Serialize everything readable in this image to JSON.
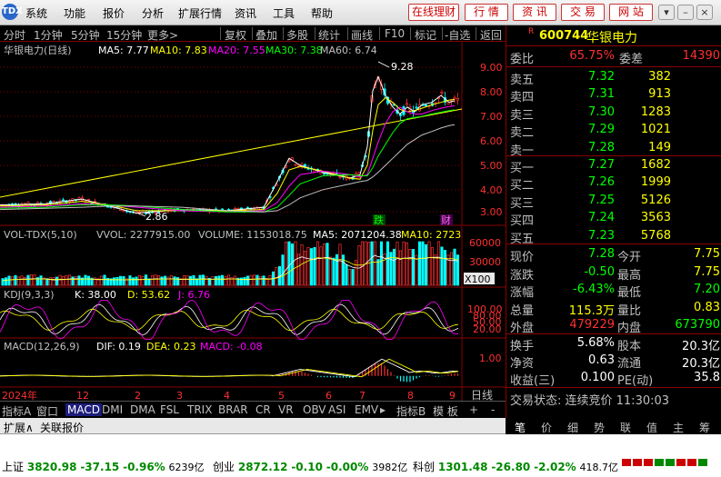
{
  "menu": {
    "logo": "TDX",
    "items": [
      "系统",
      "功能",
      "报价",
      "分析",
      "扩展行情",
      "资讯",
      "工具",
      "帮助"
    ],
    "buttons": [
      "在线理财",
      "行 情",
      "资 讯",
      "交 易",
      "网 站"
    ],
    "window_controls": [
      "▾",
      "–",
      "□",
      "×"
    ]
  },
  "timeframes": [
    "分时",
    "1分钟",
    "5分钟",
    "15分钟",
    "更多>",
    "复权",
    "叠加",
    "多股",
    "统计",
    "画线",
    "F10",
    "标记",
    "-自选",
    "返回"
  ],
  "main_chart": {
    "title": "华银电力(日线)",
    "ma5": "MA5: 7.77",
    "ma10": "MA10: 7.83",
    "ma20": "MA20: 7.55",
    "ma30": "MA30: 7.38",
    "ma60": "MA60: 6.74",
    "high_label": "9.28",
    "low_label": "2.86",
    "marker_die": "跌",
    "marker_cai": "财",
    "y_ticks": [
      "9.00",
      "8.00",
      "7.00",
      "6.00",
      "5.00",
      "4.00",
      "3.00"
    ]
  },
  "volume_chart": {
    "title": "VOL-TDX(5,10)",
    "vvol": "VVOL: 2277915.00",
    "volume": "VOLUME: 1153018.75",
    "ma5": "MA5: 2071204.38",
    "ma10": "MA10: 2723",
    "y_ticks": [
      "60000",
      "30000"
    ],
    "unit": "X100"
  },
  "kdj_chart": {
    "title": "KDJ(9,3,3)",
    "k": "K: 38.00",
    "d": "D: 53.62",
    "j": "J: 6.76",
    "y_ticks": [
      "100.00",
      "80.00",
      "50.00",
      "20.00"
    ]
  },
  "macd_chart": {
    "title": "MACD(12,26,9)",
    "dif": "DIF: 0.19",
    "dea": "DEA: 0.23",
    "macd": "MACD: -0.08",
    "y_ticks": [
      "1.00"
    ]
  },
  "time_axis": {
    "labels": [
      "2024年",
      "12",
      "2",
      "3",
      "4",
      "5",
      "6",
      "7",
      "8",
      "9"
    ],
    "period": "日线"
  },
  "chart_data": [
    {
      "type": "line",
      "title": "华银电力(日线)",
      "series": [
        {
          "name": "MA5",
          "color": "#ffffff",
          "points": [
            [
              0,
              3.3
            ],
            [
              50,
              3.35
            ],
            [
              90,
              3.55
            ],
            [
              120,
              3.25
            ],
            [
              150,
              2.95
            ],
            [
              200,
              3.1
            ],
            [
              250,
              3.05
            ],
            [
              290,
              3.2
            ],
            [
              305,
              4.3
            ],
            [
              318,
              5.3
            ],
            [
              330,
              5.0
            ],
            [
              355,
              4.7
            ],
            [
              385,
              4.45
            ],
            [
              396,
              4.6
            ],
            [
              404,
              5.8
            ],
            [
              410,
              8.2
            ],
            [
              416,
              8.8
            ],
            [
              424,
              8.0
            ],
            [
              432,
              7.5
            ],
            [
              440,
              7.2
            ],
            [
              448,
              7.5
            ],
            [
              456,
              7.3
            ],
            [
              464,
              7.6
            ],
            [
              475,
              7.7
            ],
            [
              485,
              8.0
            ],
            [
              494,
              7.7
            ],
            [
              500,
              7.77
            ]
          ]
        },
        {
          "name": "MA10",
          "color": "#ffff00",
          "points": [
            [
              0,
              3.25
            ],
            [
              50,
              3.3
            ],
            [
              90,
              3.45
            ],
            [
              120,
              3.3
            ],
            [
              150,
              3.05
            ],
            [
              200,
              3.05
            ],
            [
              250,
              3.05
            ],
            [
              290,
              3.1
            ],
            [
              305,
              3.8
            ],
            [
              318,
              4.8
            ],
            [
              330,
              4.95
            ],
            [
              355,
              4.75
            ],
            [
              385,
              4.45
            ],
            [
              396,
              4.4
            ],
            [
              404,
              5.0
            ],
            [
              410,
              6.5
            ],
            [
              416,
              7.6
            ],
            [
              424,
              7.9
            ],
            [
              432,
              7.7
            ],
            [
              440,
              7.4
            ],
            [
              448,
              7.3
            ],
            [
              456,
              7.35
            ],
            [
              464,
              7.45
            ],
            [
              475,
              7.6
            ],
            [
              485,
              7.7
            ],
            [
              494,
              7.8
            ],
            [
              500,
              7.83
            ]
          ]
        },
        {
          "name": "MA20",
          "color": "#ff00ff",
          "points": [
            [
              0,
              3.2
            ],
            [
              50,
              3.25
            ],
            [
              90,
              3.35
            ],
            [
              120,
              3.3
            ],
            [
              150,
              3.2
            ],
            [
              200,
              3.05
            ],
            [
              250,
              3.0
            ],
            [
              290,
              3.05
            ],
            [
              305,
              3.4
            ],
            [
              318,
              4.1
            ],
            [
              330,
              4.6
            ],
            [
              355,
              4.75
            ],
            [
              385,
              4.6
            ],
            [
              396,
              4.5
            ],
            [
              404,
              4.6
            ],
            [
              410,
              5.3
            ],
            [
              416,
              6.0
            ],
            [
              424,
              6.8
            ],
            [
              432,
              7.3
            ],
            [
              440,
              7.5
            ],
            [
              448,
              7.3
            ],
            [
              456,
              7.2
            ],
            [
              464,
              7.2
            ],
            [
              475,
              7.35
            ],
            [
              485,
              7.45
            ],
            [
              494,
              7.52
            ],
            [
              500,
              7.55
            ]
          ]
        },
        {
          "name": "MA30",
          "color": "#00ff00",
          "points": [
            [
              0,
              3.15
            ],
            [
              50,
              3.2
            ],
            [
              90,
              3.3
            ],
            [
              120,
              3.3
            ],
            [
              150,
              3.25
            ],
            [
              200,
              3.1
            ],
            [
              250,
              3.0
            ],
            [
              290,
              3.0
            ],
            [
              305,
              3.2
            ],
            [
              318,
              3.7
            ],
            [
              330,
              4.2
            ],
            [
              355,
              4.55
            ],
            [
              385,
              4.6
            ],
            [
              396,
              4.55
            ],
            [
              404,
              4.55
            ],
            [
              410,
              4.9
            ],
            [
              416,
              5.4
            ],
            [
              424,
              5.9
            ],
            [
              432,
              6.4
            ],
            [
              440,
              6.8
            ],
            [
              448,
              7.0
            ],
            [
              456,
              7.05
            ],
            [
              464,
              7.1
            ],
            [
              475,
              7.2
            ],
            [
              485,
              7.28
            ],
            [
              494,
              7.35
            ],
            [
              500,
              7.38
            ]
          ]
        },
        {
          "name": "MA60",
          "color": "#c0c0c0",
          "points": [
            [
              0,
              3.1
            ],
            [
              50,
              3.15
            ],
            [
              90,
              3.2
            ],
            [
              120,
              3.25
            ],
            [
              150,
              3.25
            ],
            [
              200,
              3.2
            ],
            [
              250,
              3.05
            ],
            [
              290,
              3.0
            ],
            [
              305,
              3.05
            ],
            [
              318,
              3.3
            ],
            [
              330,
              3.6
            ],
            [
              355,
              3.95
            ],
            [
              385,
              4.2
            ],
            [
              396,
              4.3
            ],
            [
              404,
              4.35
            ],
            [
              410,
              4.5
            ],
            [
              416,
              4.7
            ],
            [
              424,
              5.0
            ],
            [
              432,
              5.3
            ],
            [
              440,
              5.6
            ],
            [
              448,
              5.9
            ],
            [
              456,
              6.1
            ],
            [
              464,
              6.3
            ],
            [
              475,
              6.45
            ],
            [
              485,
              6.6
            ],
            [
              494,
              6.7
            ],
            [
              500,
              6.74
            ]
          ]
        }
      ],
      "ylim": [
        2.5,
        9.6
      ]
    },
    {
      "type": "bar",
      "title": "VOL-TDX(5,10)",
      "ylim": [
        0,
        60000
      ]
    },
    {
      "type": "line",
      "title": "KDJ(9,3,3)",
      "ylim": [
        0,
        100
      ]
    },
    {
      "type": "bar",
      "title": "MACD(12,26,9)",
      "ylim": [
        -0.5,
        1.2
      ]
    }
  ],
  "quote": {
    "code_marker": "R",
    "code": "600744",
    "name": "华银电力",
    "weibi_label": "委比",
    "weibi": "65.75%",
    "weicha_label": "委差",
    "weicha": "14390",
    "asks": [
      {
        "label": "卖五",
        "price": "7.32",
        "vol": "382"
      },
      {
        "label": "卖四",
        "price": "7.31",
        "vol": "913"
      },
      {
        "label": "卖三",
        "price": "7.30",
        "vol": "1283"
      },
      {
        "label": "卖二",
        "price": "7.29",
        "vol": "1021"
      },
      {
        "label": "卖一",
        "price": "7.28",
        "vol": "149"
      }
    ],
    "bids": [
      {
        "label": "买一",
        "price": "7.27",
        "vol": "1682"
      },
      {
        "label": "买二",
        "price": "7.26",
        "vol": "1999"
      },
      {
        "label": "买三",
        "price": "7.25",
        "vol": "5126"
      },
      {
        "label": "买四",
        "price": "7.24",
        "vol": "3563"
      },
      {
        "label": "买五",
        "price": "7.23",
        "vol": "5768"
      }
    ],
    "stats": [
      {
        "l1": "现价",
        "v1": "7.28",
        "c1": "#00ff00",
        "l2": "今开",
        "v2": "7.75",
        "c2": "#ffff00"
      },
      {
        "l1": "涨跌",
        "v1": "-0.50",
        "c1": "#00ff00",
        "l2": "最高",
        "v2": "7.75",
        "c2": "#ffff00"
      },
      {
        "l1": "涨幅",
        "v1": "-6.43%",
        "c1": "#00ff00",
        "l2": "最低",
        "v2": "7.20",
        "c2": "#00ff00"
      },
      {
        "l1": "总量",
        "v1": "115.3万",
        "c1": "#ffff00",
        "l2": "量比",
        "v2": "0.83",
        "c2": "#ffff00"
      },
      {
        "l1": "外盘",
        "v1": "479229",
        "c1": "#ff3030",
        "l2": "内盘",
        "v2": "673790",
        "c2": "#00ff00"
      }
    ],
    "stats2": [
      {
        "l1": "换手",
        "v1": "5.68%",
        "l2": "股本",
        "v2": "20.3亿"
      },
      {
        "l1": "净资",
        "v1": "0.63",
        "l2": "流通",
        "v2": "20.3亿"
      },
      {
        "l1": "收益(三)",
        "v1": "0.100",
        "l2": "PE(动)",
        "v2": "35.8"
      }
    ],
    "trade_state": "交易状态: 连续竞价 11:30:03"
  },
  "bottom_tabs": [
    "指标A",
    "窗口",
    "MACD",
    "DMI",
    "DMA",
    "FSL",
    "TRIX",
    "BRAR",
    "CR",
    "VR",
    "OBV",
    "ASI",
    "EMV",
    "▸",
    "指标B",
    "模 板",
    "+",
    "-"
  ],
  "ext_tabs": [
    "扩展∧",
    "关联报价"
  ],
  "right_tabs": [
    "笔",
    "价",
    "细",
    "势",
    "联",
    "值",
    "主",
    "筹"
  ],
  "indices": [
    {
      "name": "上证",
      "val": "3820.98",
      "chg": "-37.15",
      "pct": "-0.96%",
      "amt": "6239亿"
    },
    {
      "name": "创业",
      "val": "2872.12",
      "chg": "-0.10",
      "pct": "-0.00%",
      "amt": "3982亿"
    },
    {
      "name": "科创",
      "val": "1301.48",
      "chg": "-26.80",
      "pct": "-2.02%",
      "amt": "418.7亿"
    }
  ]
}
